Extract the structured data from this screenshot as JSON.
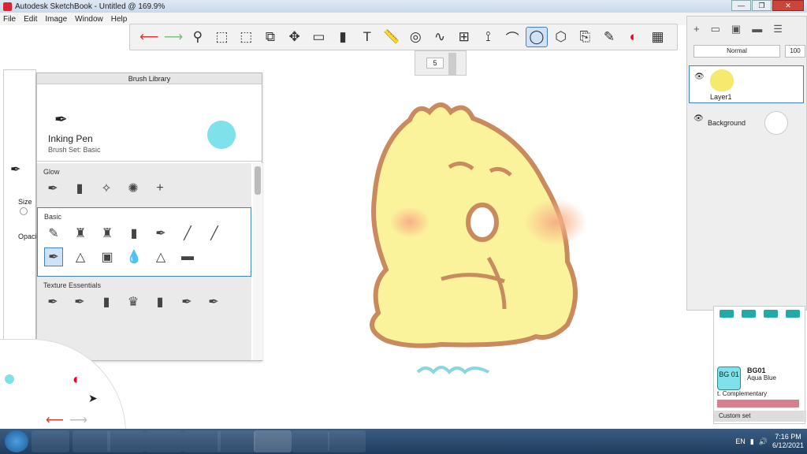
{
  "window": {
    "title": "Autodesk SketchBook - Untitled @ 169.9%"
  },
  "menu": [
    "File",
    "Edit",
    "Image",
    "Window",
    "Help"
  ],
  "toolbar": {
    "brush_size_value": "5"
  },
  "brush_library": {
    "title": "Brush Library",
    "current_brush": "Inking Pen",
    "brush_set": "Brush Set: Basic",
    "current_color": "#7fe1e9",
    "sections": [
      "Glow",
      "Basic",
      "Texture Essentials"
    ]
  },
  "side_props": {
    "size_label": "Size",
    "opacity_label": "Opacit"
  },
  "layers": {
    "blend_mode": "Normal",
    "opacity": "100",
    "items": [
      {
        "name": "Layer1"
      },
      {
        "name": "Background"
      }
    ]
  },
  "swatches": {
    "copic_code": "BG01",
    "copic_short": "BG 01",
    "copic_name": "Aqua Blue",
    "complementary": "t. Complementary",
    "custom_set": "Custom set"
  },
  "taskbar": {
    "language": "EN",
    "time": "7:16 PM",
    "date": "6/12/2021"
  }
}
